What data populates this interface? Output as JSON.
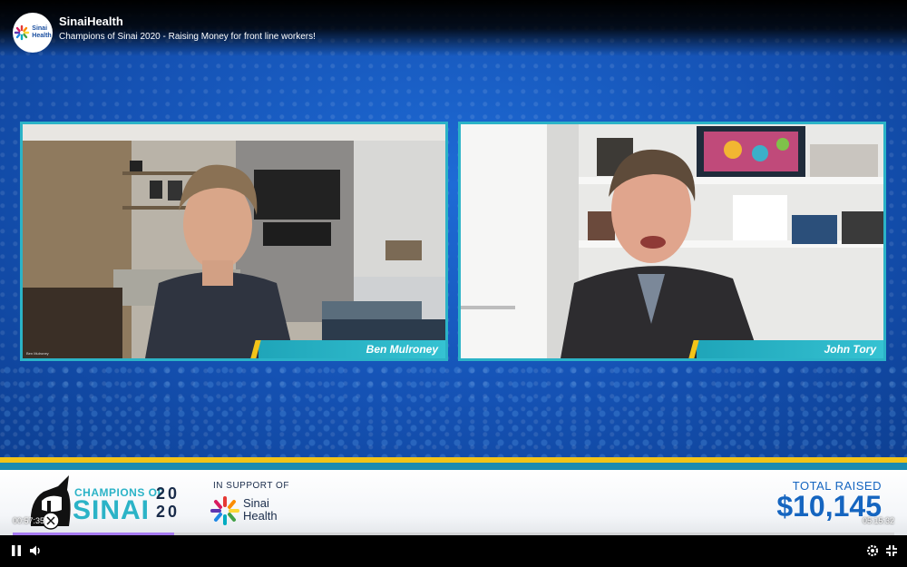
{
  "channel": {
    "name": "SinaiHealth",
    "logo_text": "Sinai\nHealth",
    "video_title": "Champions of Sinai 2020 - Raising Money for front line workers!"
  },
  "participants": [
    {
      "name": "Ben Mulroney",
      "small_label": "Ben Mulroney"
    },
    {
      "name": "John Tory"
    }
  ],
  "banner": {
    "champions_of": "CHAMPIONS OF",
    "sinai": "SINAI",
    "year_top": "20",
    "year_bottom": "20",
    "in_support": "IN SUPPORT OF",
    "sinai_health": "Sinai\nHealth",
    "total_label": "TOTAL RAISED",
    "total_amount": "$10,145"
  },
  "player": {
    "current_time": "00:57:35",
    "total_time": "05:15:32",
    "progress_fraction": 0.183,
    "icons": {
      "play_pause": "pause-icon",
      "volume": "volume-icon",
      "settings": "gear-icon",
      "fullscreen": "exit-fullscreen-icon"
    }
  },
  "colors": {
    "accent_teal": "#2bb3c7",
    "accent_yellow": "#f2c318",
    "brand_blue": "#1565c0",
    "progress": "#a77bf3"
  }
}
